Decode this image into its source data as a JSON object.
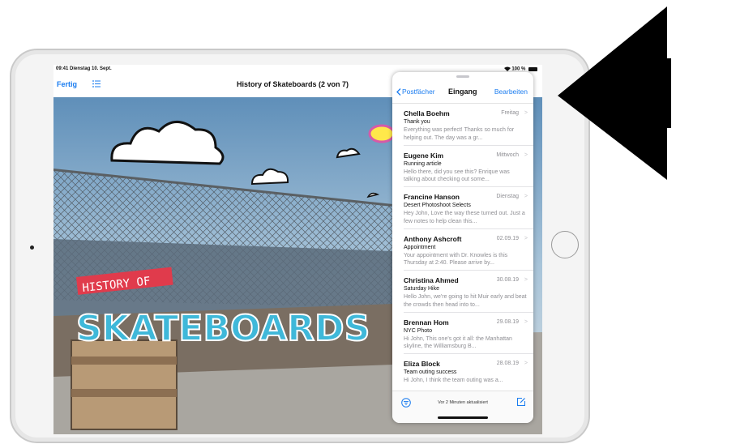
{
  "status_bar": {
    "time_date": "09:41  Dienstag 10. Sept.",
    "battery": "100 %"
  },
  "keynote": {
    "done_label": "Fertig",
    "title": "History of Skateboards (2 von 7)",
    "slide_text_line1": "HISTORY OF",
    "slide_text_line2": "SKATEBOARDS"
  },
  "mail": {
    "back_label": "Postfächer",
    "title": "Eingang",
    "edit_label": "Bearbeiten",
    "messages": [
      {
        "sender": "Chella Boehm",
        "date": "Freitag",
        "subject": "Thank you",
        "preview": "Everything was perfect! Thanks so much for helping out. The day was a gr..."
      },
      {
        "sender": "Eugene Kim",
        "date": "Mittwoch",
        "subject": "Running article",
        "preview": "Hello there, did you see this? Enrique was talking about checking out some..."
      },
      {
        "sender": "Francine Hanson",
        "date": "Dienstag",
        "subject": "Desert Photoshoot Selects",
        "preview": "Hey John, Love the way these turned out. Just a few notes to help clean this..."
      },
      {
        "sender": "Anthony Ashcroft",
        "date": "02.09.19",
        "subject": "Appointment",
        "preview": "Your appointment with Dr. Knowles is this Thursday at 2:40. Please arrive by..."
      },
      {
        "sender": "Christina Ahmed",
        "date": "30.08.19",
        "subject": "Saturday Hike",
        "preview": "Hello John, we're going to hit Muir early and beat the crowds then head into to..."
      },
      {
        "sender": "Brennan Hom",
        "date": "29.08.19",
        "subject": "NYC Photo",
        "preview": "Hi John, This one's got it all: the Manhattan skyline, the Williamsburg B..."
      },
      {
        "sender": "Eliza Block",
        "date": "28.08.19",
        "subject": "Team outing success",
        "preview": "Hi John, I think the team outing was a..."
      }
    ],
    "updated_text": "Vor 2 Minuten aktualisiert"
  },
  "icons": {
    "list": "list-icon",
    "back": "chevron-left-icon",
    "filter": "filter-icon",
    "compose": "compose-icon",
    "wifi": "wifi-icon"
  },
  "colors": {
    "accent": "#1a7cf0",
    "arrow": "#000000"
  }
}
